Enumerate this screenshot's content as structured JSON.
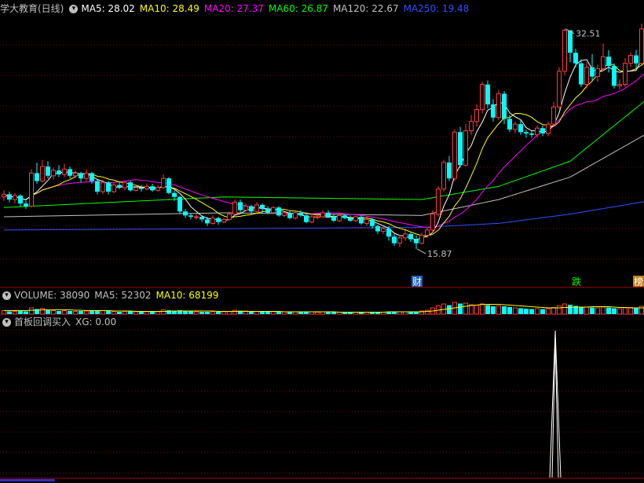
{
  "main_header": {
    "title": "学大教育(日线)",
    "items": [
      {
        "label": "MA5: 28.02",
        "color": "#ffffff"
      },
      {
        "label": "MA10: 28.49",
        "color": "#ffff00"
      },
      {
        "label": "MA20: 27.37",
        "color": "#ff00ff"
      },
      {
        "label": "MA60: 26.87",
        "color": "#00ff00"
      },
      {
        "label": "MA120: 22.67",
        "color": "#c0c0c0"
      },
      {
        "label": "MA250: 19.48",
        "color": "#3050ff"
      }
    ]
  },
  "volume_header": {
    "items": [
      {
        "label": "VOLUME: 38090",
        "color": "#c0c0c0"
      },
      {
        "label": "MA5: 52302",
        "color": "#c0c0c0"
      },
      {
        "label": "MA10: 68199",
        "color": "#ffff00"
      }
    ]
  },
  "indicator_header": {
    "items": [
      {
        "label": "首板回调买入",
        "color": "#c0c0c0"
      },
      {
        "label": "XG: 0.00",
        "color": "#c0c0c0"
      }
    ]
  },
  "annotations": {
    "high_label": "32.51",
    "low_label": "15.87",
    "markers": [
      {
        "text": "财",
        "bg": "#2060c0",
        "color": "#ffffff",
        "index": 75
      },
      {
        "text": "跌",
        "bg": "#000000",
        "color": "#00ff00",
        "index": 104
      },
      {
        "text": "榜",
        "bg": "#c08020",
        "color": "#ffffff",
        "index": 117
      }
    ]
  },
  "colors": {
    "up": "#ff3c3c",
    "down": "#00ffff",
    "grid": "#8b0000",
    "frame": "#b00000"
  },
  "chart_data": {
    "type": "candlestick",
    "price_range": [
      14.5,
      33.5
    ],
    "high": 32.51,
    "low": 15.87,
    "candles": [
      [
        19.8,
        20.0,
        20.3,
        19.5
      ],
      [
        20.0,
        19.6,
        20.2,
        19.4
      ],
      [
        19.6,
        19.9,
        20.1,
        19.3
      ],
      [
        19.9,
        19.3,
        20.0,
        19.1
      ],
      [
        19.3,
        19.1,
        19.5,
        18.9
      ],
      [
        19.1,
        21.6,
        21.9,
        19.0
      ],
      [
        21.6,
        21.0,
        22.4,
        20.8
      ],
      [
        21.0,
        22.1,
        22.6,
        20.9
      ],
      [
        22.1,
        21.4,
        22.5,
        21.2
      ],
      [
        21.4,
        21.8,
        22.0,
        21.1
      ],
      [
        21.8,
        21.5,
        22.2,
        21.3
      ],
      [
        21.5,
        21.9,
        22.3,
        21.3
      ],
      [
        21.9,
        21.4,
        22.1,
        21.2
      ],
      [
        21.4,
        21.6,
        21.8,
        21.2
      ],
      [
        21.6,
        21.2,
        21.7,
        20.9
      ],
      [
        21.2,
        21.6,
        21.9,
        21.0
      ],
      [
        21.6,
        21.0,
        21.7,
        20.8
      ],
      [
        21.0,
        20.2,
        21.1,
        20.0
      ],
      [
        20.2,
        20.9,
        21.1,
        20.0
      ],
      [
        20.9,
        20.2,
        21.0,
        20.0
      ],
      [
        20.2,
        20.7,
        20.9,
        20.1
      ],
      [
        20.7,
        20.5,
        20.9,
        20.4
      ],
      [
        20.5,
        20.9,
        21.0,
        20.3
      ],
      [
        20.9,
        20.3,
        21.0,
        20.2
      ],
      [
        20.3,
        20.5,
        20.6,
        20.2
      ],
      [
        20.5,
        20.4,
        20.7,
        20.2
      ],
      [
        20.4,
        20.6,
        20.8,
        20.3
      ],
      [
        20.6,
        20.3,
        20.8,
        20.2
      ],
      [
        20.3,
        20.5,
        20.7,
        20.2
      ],
      [
        20.5,
        21.2,
        21.5,
        20.4
      ],
      [
        21.2,
        20.1,
        21.3,
        20.0
      ],
      [
        20.1,
        19.8,
        20.3,
        19.5
      ],
      [
        19.8,
        18.7,
        19.9,
        18.5
      ],
      [
        18.7,
        18.4,
        18.9,
        18.2
      ],
      [
        18.4,
        18.3,
        18.6,
        18.1
      ],
      [
        18.3,
        18.3,
        18.5,
        18.1
      ],
      [
        18.3,
        18.1,
        18.4,
        17.9
      ],
      [
        18.1,
        17.8,
        18.3,
        17.6
      ],
      [
        17.8,
        18.2,
        18.4,
        17.7
      ],
      [
        18.2,
        17.9,
        18.3,
        17.7
      ],
      [
        17.9,
        18.1,
        18.2,
        17.8
      ],
      [
        18.1,
        18.5,
        18.7,
        18.0
      ],
      [
        18.5,
        19.4,
        19.6,
        18.4
      ],
      [
        19.4,
        18.8,
        19.6,
        18.6
      ],
      [
        18.8,
        19.1,
        19.3,
        18.7
      ],
      [
        19.1,
        18.7,
        19.2,
        18.5
      ],
      [
        18.7,
        19.2,
        19.4,
        18.6
      ],
      [
        19.2,
        18.9,
        19.3,
        18.6
      ],
      [
        18.9,
        18.6,
        19.1,
        18.5
      ],
      [
        18.6,
        19.0,
        19.1,
        18.5
      ],
      [
        19.0,
        18.4,
        19.1,
        18.3
      ],
      [
        18.4,
        18.6,
        18.7,
        18.3
      ],
      [
        18.6,
        18.2,
        18.8,
        18.1
      ],
      [
        18.2,
        18.6,
        18.7,
        18.1
      ],
      [
        18.6,
        18.4,
        18.8,
        18.3
      ],
      [
        18.4,
        17.9,
        18.6,
        17.8
      ],
      [
        17.9,
        18.3,
        18.5,
        17.8
      ],
      [
        18.3,
        18.3,
        18.5,
        18.1
      ],
      [
        18.3,
        18.6,
        18.8,
        18.2
      ],
      [
        18.6,
        18.3,
        18.8,
        18.2
      ],
      [
        18.3,
        18.0,
        18.5,
        17.9
      ],
      [
        18.0,
        18.4,
        18.6,
        17.9
      ],
      [
        18.4,
        18.2,
        18.5,
        18.1
      ],
      [
        18.2,
        18.0,
        18.4,
        17.9
      ],
      [
        18.0,
        18.3,
        18.4,
        17.9
      ],
      [
        18.3,
        17.8,
        18.4,
        17.7
      ],
      [
        17.8,
        18.1,
        18.3,
        17.6
      ],
      [
        18.1,
        17.6,
        18.2,
        17.4
      ],
      [
        17.6,
        17.2,
        17.7,
        17.0
      ],
      [
        17.2,
        17.4,
        17.6,
        17.0
      ],
      [
        17.4,
        16.8,
        17.6,
        16.5
      ],
      [
        16.8,
        16.3,
        17.0,
        16.1
      ],
      [
        16.3,
        16.7,
        16.9,
        16.0
      ],
      [
        16.7,
        17.0,
        17.3,
        16.5
      ],
      [
        17.0,
        16.6,
        17.1,
        16.4
      ],
      [
        16.6,
        16.3,
        16.9,
        15.87
      ],
      [
        16.3,
        16.9,
        17.1,
        16.2
      ],
      [
        16.9,
        17.3,
        17.5,
        16.7
      ],
      [
        17.3,
        18.5,
        18.8,
        17.1
      ],
      [
        18.5,
        20.4,
        20.6,
        18.3
      ],
      [
        20.4,
        22.4,
        22.6,
        20.2
      ],
      [
        22.4,
        21.2,
        22.9,
        21.0
      ],
      [
        21.2,
        24.7,
        24.9,
        21.0
      ],
      [
        24.7,
        22.2,
        25.1,
        22.0
      ],
      [
        22.2,
        24.8,
        25.3,
        22.1
      ],
      [
        24.8,
        25.5,
        26.0,
        24.5
      ],
      [
        25.5,
        26.4,
        26.8,
        25.1
      ],
      [
        26.4,
        28.3,
        28.5,
        26.1
      ],
      [
        28.3,
        26.8,
        28.6,
        26.5
      ],
      [
        26.8,
        25.8,
        27.2,
        25.5
      ],
      [
        25.8,
        27.6,
        27.9,
        25.6
      ],
      [
        27.6,
        25.7,
        27.8,
        25.3
      ],
      [
        25.7,
        24.9,
        26.0,
        24.7
      ],
      [
        24.9,
        25.3,
        25.5,
        24.6
      ],
      [
        25.3,
        24.7,
        25.6,
        24.5
      ],
      [
        24.7,
        24.6,
        24.9,
        24.3
      ],
      [
        24.6,
        24.5,
        24.8,
        24.3
      ],
      [
        24.5,
        25.0,
        25.2,
        24.3
      ],
      [
        25.0,
        24.6,
        25.2,
        24.4
      ],
      [
        24.6,
        25.3,
        25.5,
        24.4
      ],
      [
        25.3,
        26.6,
        27.0,
        25.1
      ],
      [
        26.6,
        29.3,
        29.6,
        26.4
      ],
      [
        29.3,
        32.4,
        32.51,
        29.0
      ],
      [
        32.4,
        30.7,
        32.4,
        30.0
      ],
      [
        30.7,
        29.9,
        31.0,
        29.6
      ],
      [
        29.9,
        28.3,
        30.2,
        28.1
      ],
      [
        28.3,
        29.6,
        30.0,
        28.0
      ],
      [
        29.6,
        28.9,
        30.6,
        28.6
      ],
      [
        28.9,
        29.5,
        29.8,
        28.5
      ],
      [
        29.5,
        30.4,
        31.4,
        29.3
      ],
      [
        30.4,
        29.7,
        30.9,
        29.2
      ],
      [
        29.7,
        28.2,
        29.9,
        28.0
      ],
      [
        28.2,
        28.3,
        28.7,
        27.9
      ],
      [
        28.3,
        29.9,
        30.3,
        28.1
      ],
      [
        29.9,
        30.5,
        30.7,
        29.6
      ],
      [
        30.5,
        29.9,
        30.9,
        29.5
      ],
      [
        29.9,
        32.5,
        32.9,
        29.8
      ],
      [
        32.5,
        30.9,
        33.0,
        30.5
      ]
    ],
    "volumes": [
      0.9,
      0.7,
      0.7,
      0.8,
      0.7,
      1.6,
      1.3,
      1.5,
      1.1,
      0.9,
      0.8,
      0.9,
      0.8,
      0.7,
      0.8,
      0.8,
      0.8,
      1.0,
      0.9,
      0.8,
      0.7,
      0.6,
      0.7,
      0.7,
      0.6,
      0.6,
      0.6,
      0.6,
      0.6,
      1.1,
      1.0,
      0.9,
      1.0,
      0.8,
      0.7,
      0.6,
      0.6,
      0.6,
      0.6,
      0.6,
      0.6,
      0.7,
      1.0,
      0.9,
      0.8,
      0.7,
      0.7,
      0.6,
      0.6,
      0.6,
      0.6,
      0.6,
      0.6,
      0.6,
      0.6,
      0.6,
      0.6,
      0.5,
      0.6,
      0.6,
      0.5,
      0.5,
      0.5,
      0.5,
      0.5,
      0.5,
      0.5,
      0.5,
      0.6,
      0.5,
      0.6,
      0.7,
      0.6,
      0.6,
      0.5,
      0.7,
      0.8,
      1.0,
      1.6,
      2.2,
      2.6,
      2.3,
      3.0,
      2.7,
      2.8,
      2.4,
      2.3,
      2.6,
      2.3,
      2.0,
      2.1,
      2.0,
      1.8,
      1.6,
      1.5,
      1.4,
      1.3,
      1.4,
      1.3,
      1.4,
      1.7,
      2.1,
      2.6,
      2.4,
      2.1,
      1.9,
      1.8,
      1.7,
      1.6,
      1.8,
      1.7,
      1.5,
      1.4,
      1.6,
      1.7,
      1.5,
      2.0,
      1.8
    ],
    "volume_ma10": [
      0.9,
      0.9,
      0.9,
      0.9,
      0.9,
      1.0,
      1.0,
      1.1,
      1.1,
      1.1,
      1.1,
      1.1,
      1.1,
      1.0,
      1.0,
      0.9,
      0.9,
      0.9,
      0.9,
      0.9,
      0.8,
      0.8,
      0.8,
      0.8,
      0.7,
      0.7,
      0.7,
      0.7,
      0.7,
      0.7,
      0.7,
      0.8,
      0.8,
      0.8,
      0.8,
      0.8,
      0.8,
      0.8,
      0.8,
      0.7,
      0.7,
      0.7,
      0.7,
      0.7,
      0.7,
      0.7,
      0.7,
      0.7,
      0.7,
      0.7,
      0.7,
      0.6,
      0.6,
      0.6,
      0.6,
      0.6,
      0.6,
      0.6,
      0.6,
      0.6,
      0.6,
      0.5,
      0.5,
      0.5,
      0.5,
      0.5,
      0.5,
      0.5,
      0.5,
      0.5,
      0.6,
      0.6,
      0.6,
      0.6,
      0.6,
      0.6,
      0.6,
      0.7,
      0.8,
      1.0,
      1.2,
      1.4,
      1.6,
      1.8,
      2.0,
      2.2,
      2.3,
      2.5,
      2.5,
      2.5,
      2.5,
      2.4,
      2.3,
      2.2,
      2.1,
      2.0,
      1.9,
      1.8,
      1.7,
      1.6,
      1.6,
      1.6,
      1.7,
      1.7,
      1.8,
      1.8,
      1.8,
      1.9,
      1.9,
      1.9,
      1.9,
      1.8,
      1.7,
      1.7,
      1.6,
      1.6,
      1.6,
      1.6
    ],
    "volume_ma5_peak": 1,
    "ma_long": {
      "MA60": [
        [
          0,
          19.0
        ],
        [
          40,
          19.8
        ],
        [
          76,
          19.6
        ],
        [
          90,
          20.6
        ],
        [
          103,
          22.5
        ],
        [
          117,
          27.2
        ]
      ],
      "MA120": [
        [
          0,
          18.3
        ],
        [
          40,
          18.6
        ],
        [
          76,
          18.4
        ],
        [
          90,
          19.6
        ],
        [
          103,
          21.3
        ],
        [
          117,
          24.6
        ]
      ],
      "MA250": [
        [
          0,
          17.3
        ],
        [
          40,
          17.4
        ],
        [
          76,
          17.5
        ],
        [
          90,
          17.8
        ],
        [
          103,
          18.5
        ],
        [
          117,
          19.48
        ]
      ]
    },
    "xg_signal_index": 100
  }
}
